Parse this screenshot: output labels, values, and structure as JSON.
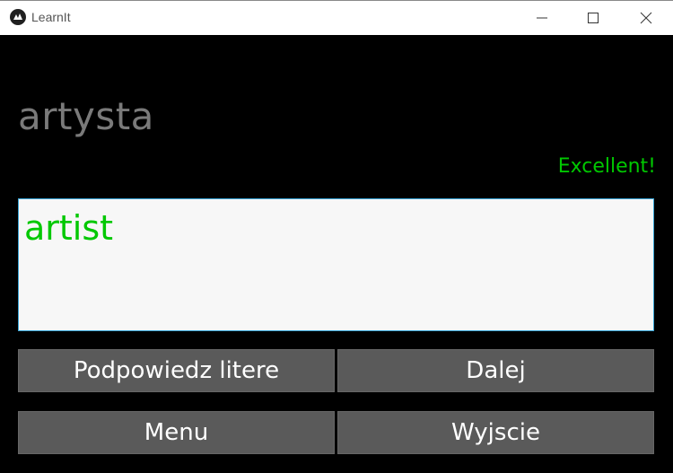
{
  "window": {
    "title": "LearnIt",
    "icon": "kivy-logo-icon"
  },
  "main": {
    "word": "artysta",
    "feedback": "Excellent!",
    "feedback_color": "#00c800",
    "answer_value": "artist"
  },
  "buttons": {
    "hint": "Podpowiedz litere",
    "next": "Dalej",
    "menu": "Menu",
    "exit": "Wyjscie"
  }
}
